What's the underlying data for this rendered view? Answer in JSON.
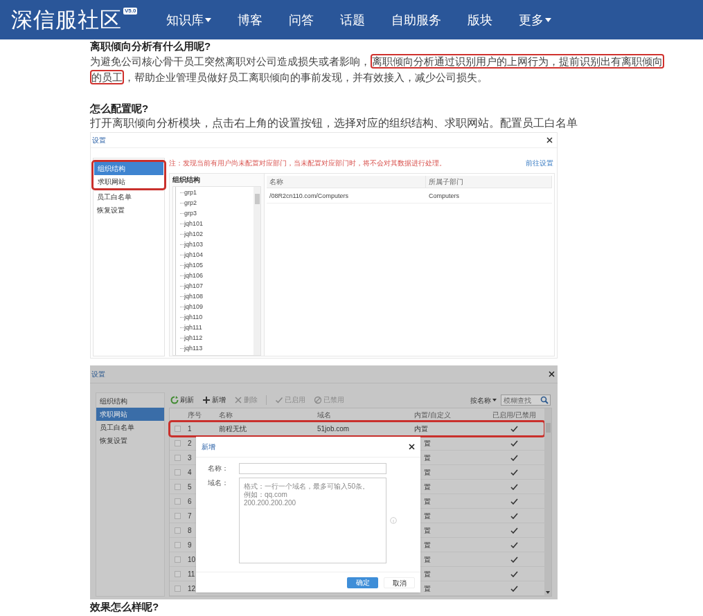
{
  "header": {
    "logo": "深信服社区",
    "version_badge": "V5.0",
    "nav": [
      {
        "label": "知识库",
        "dropdown": true
      },
      {
        "label": "博客",
        "dropdown": false
      },
      {
        "label": "问答",
        "dropdown": false
      },
      {
        "label": "话题",
        "dropdown": false
      },
      {
        "label": "自助服务",
        "dropdown": false
      },
      {
        "label": "版块",
        "dropdown": false
      },
      {
        "label": "更多",
        "dropdown": true
      }
    ]
  },
  "article": {
    "heading_1": "离职倾向分析有什么用呢?",
    "paragraph_1": [
      {
        "text": "为避免公司核心骨干员工突然离职对公司造成损失或者影响，",
        "highlighted": false
      },
      {
        "text": "离职倾向分析通过识别用户的上网行为，提前识别出有离职倾向",
        "highlighted": true
      },
      {
        "text": "的员工",
        "highlighted": true
      },
      {
        "text": "，帮助企业管理员做好员工离职倾向的事前发现，并有效接入，减少公司损失。",
        "highlighted": false
      }
    ],
    "heading_2": "怎么配置呢?",
    "paragraph_2": "打开离职倾向分析模块，点击右上角的设置按钮，选择对应的组织结构、求职网站。配置员工白名单",
    "heading_3": "效果怎么样呢?"
  },
  "settings_screenshot_1": {
    "title": "设置",
    "nav": [
      {
        "label": "组织结构",
        "selected": true,
        "highlighted": true
      },
      {
        "label": "求职网站",
        "selected": false,
        "highlighted": true
      },
      {
        "label": "员工白名单",
        "selected": false,
        "highlighted": false
      },
      {
        "label": "恢复设置",
        "selected": false,
        "highlighted": false
      }
    ],
    "notice": "注：发现当前有用户尚未配置对应部门，当未配置对应部门时，将不会对其数据进行处理。",
    "notice_link": "前往设置",
    "tree_header": "组织结构",
    "tree_items": [
      "grp1",
      "grp2",
      "grp3",
      "jqh101",
      "jqh102",
      "jqh103",
      "jqh104",
      "jqh105",
      "jqh106",
      "jqh107",
      "jqh108",
      "jqh109",
      "jqh110",
      "jqh111",
      "jqh112",
      "jqh113"
    ],
    "table": {
      "columns": [
        "名称",
        "所属子部门"
      ],
      "rows": [
        [
          "/08R2cn110.com/Computers",
          "Computers"
        ]
      ]
    }
  },
  "settings_screenshot_2": {
    "title": "设置",
    "nav": [
      {
        "label": "组织结构",
        "selected": false
      },
      {
        "label": "求职网站",
        "selected": true
      },
      {
        "label": "员工白名单",
        "selected": false
      },
      {
        "label": "恢复设置",
        "selected": false
      }
    ],
    "toolbar": [
      {
        "label": "刷新",
        "kind": "refresh",
        "disabled": false
      },
      {
        "label": "新增",
        "kind": "add",
        "disabled": false
      },
      {
        "label": "删除",
        "kind": "delete",
        "disabled": true
      },
      {
        "label": "已启用",
        "kind": "enable",
        "disabled": true
      },
      {
        "label": "已禁用",
        "kind": "disable",
        "disabled": true
      }
    ],
    "search_scope": "按名称",
    "search": {
      "placeholder": "模糊查找"
    },
    "table": {
      "columns": [
        "序号",
        "名称",
        "域名",
        "内置/自定义",
        "已启用/已禁用"
      ],
      "rows": [
        {
          "no": "1",
          "name": "前程无忧",
          "domain": "51job.com",
          "type": "内置",
          "enabled": true,
          "checked": false,
          "highlighted": true
        },
        {
          "no": "2",
          "type": "置",
          "enabled": true,
          "checked": false,
          "highlighted": false
        },
        {
          "no": "3",
          "type": "置",
          "enabled": true,
          "checked": false,
          "highlighted": false
        },
        {
          "no": "4",
          "type": "置",
          "enabled": true,
          "checked": false,
          "highlighted": false
        },
        {
          "no": "5",
          "type": "置",
          "enabled": true,
          "checked": false,
          "highlighted": false
        },
        {
          "no": "6",
          "type": "置",
          "enabled": true,
          "checked": false,
          "highlighted": false
        },
        {
          "no": "7",
          "type": "置",
          "enabled": true,
          "checked": false,
          "highlighted": false
        },
        {
          "no": "8",
          "type": "置",
          "enabled": true,
          "checked": false,
          "highlighted": false
        },
        {
          "no": "9",
          "type": "置",
          "enabled": true,
          "checked": false,
          "highlighted": false
        },
        {
          "no": "10",
          "type": "置",
          "enabled": true,
          "checked": false,
          "highlighted": false
        },
        {
          "no": "11",
          "type": "置",
          "enabled": true,
          "checked": false,
          "highlighted": false
        },
        {
          "no": "12",
          "type": "置",
          "enabled": true,
          "checked": false,
          "highlighted": false
        }
      ]
    },
    "add_dialog": {
      "title": "新增",
      "fields": [
        {
          "label": "名称：",
          "kind": "input"
        },
        {
          "label": "域名：",
          "kind": "textarea",
          "placeholder": [
            "格式：一行一个域名，最多可输入50条。",
            "例如：qq.com",
            "200.200.200.200"
          ]
        }
      ],
      "buttons": [
        {
          "label": "确定",
          "primary": true
        },
        {
          "label": "取消",
          "primary": false
        }
      ]
    }
  }
}
